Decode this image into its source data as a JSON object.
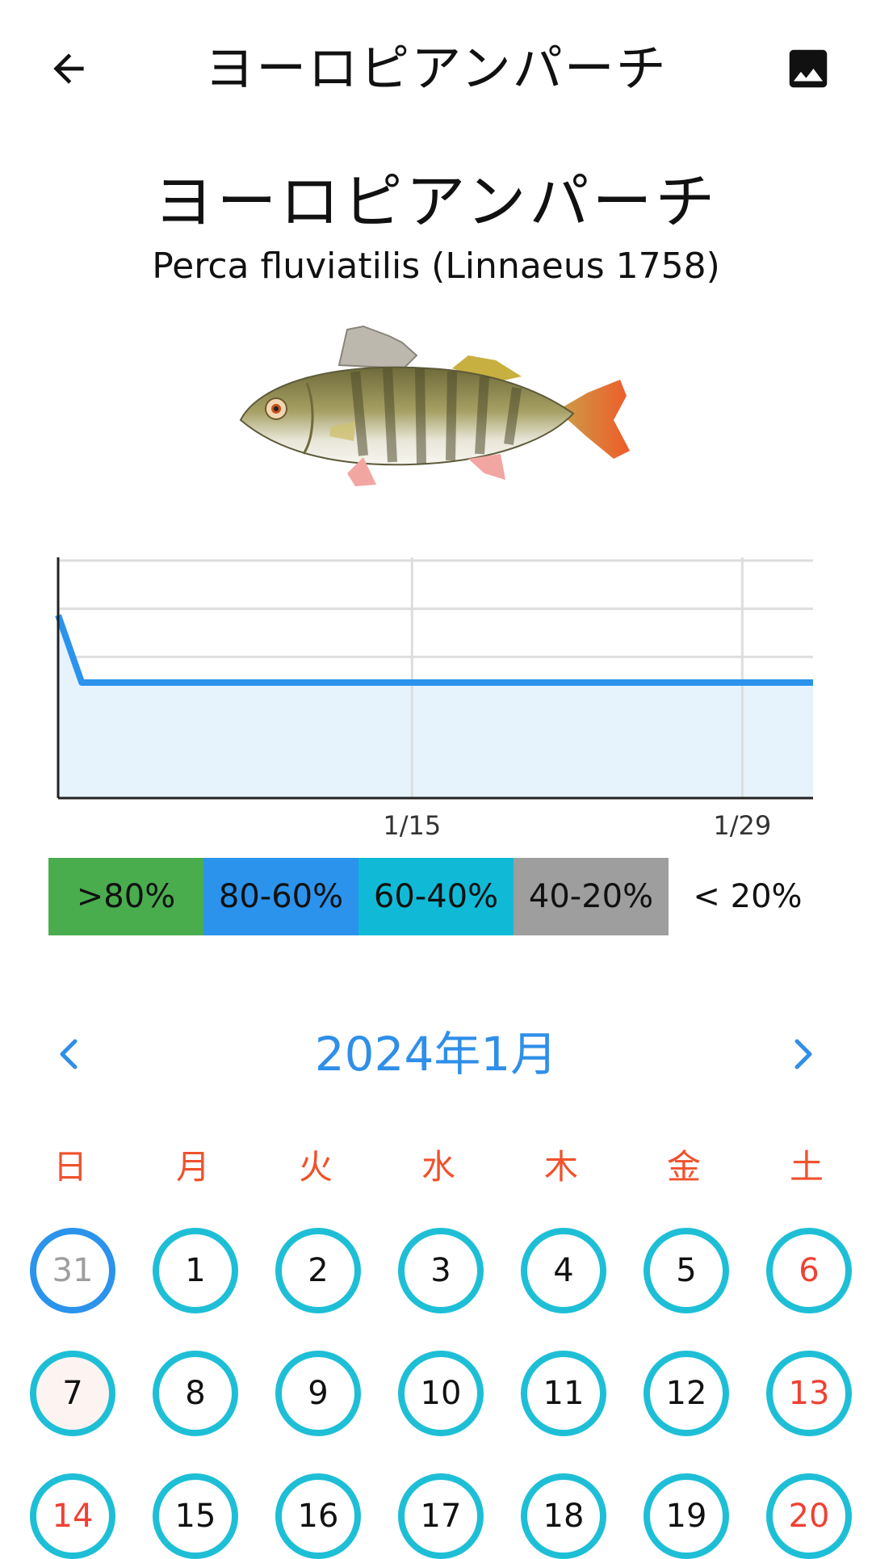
{
  "appbar": {
    "title": "ヨーロピアンパーチ",
    "back_icon": "arrow-back-icon",
    "image_icon": "image-icon"
  },
  "fish": {
    "name": "ヨーロピアンパーチ",
    "scientific": "Perca fluviatilis (Linnaeus 1758)"
  },
  "chart_data": {
    "type": "area",
    "x_tick_labels": [
      "1/15",
      "1/29"
    ],
    "points": [
      {
        "x": "12/31",
        "y": 0.76
      },
      {
        "x": "1/1",
        "y": 0.48
      },
      {
        "x": "2/1",
        "y": 0.48
      }
    ],
    "ylim": [
      0,
      1
    ],
    "grid": true,
    "line_color": "#2b93ec",
    "fill_color": "#e6f3fd"
  },
  "legend": [
    {
      "label": ">80%",
      "color": "#49ad4e"
    },
    {
      "label": "80-60%",
      "color": "#2b93ec"
    },
    {
      "label": "60-40%",
      "color": "#10bad6"
    },
    {
      "label": "40-20%",
      "color": "#9e9e9e"
    },
    {
      "label": "< 20%",
      "color": "#ffffff"
    }
  ],
  "calendar": {
    "month_label": "2024年1月",
    "prev_icon": "chevron-left-icon",
    "next_icon": "chevron-right-icon",
    "weekdays": [
      "日",
      "月",
      "火",
      "水",
      "木",
      "金",
      "土"
    ],
    "days": [
      {
        "label": "31",
        "outside_month": true
      },
      {
        "label": "1"
      },
      {
        "label": "2"
      },
      {
        "label": "3"
      },
      {
        "label": "4"
      },
      {
        "label": "5"
      },
      {
        "label": "6",
        "weekend": true
      },
      {
        "label": "7",
        "weekend": true,
        "today": true
      },
      {
        "label": "8"
      },
      {
        "label": "9"
      },
      {
        "label": "10"
      },
      {
        "label": "11"
      },
      {
        "label": "12"
      },
      {
        "label": "13",
        "weekend": true
      },
      {
        "label": "14",
        "weekend": true
      },
      {
        "label": "15"
      },
      {
        "label": "16"
      },
      {
        "label": "17"
      },
      {
        "label": "18"
      },
      {
        "label": "19"
      },
      {
        "label": "20",
        "weekend": true
      }
    ],
    "colors": {
      "ring": "#1ebfd6",
      "outside_ring": "#2b93ec",
      "weekend_text": "#ee4234",
      "outside_text": "#9e9e9e",
      "today_fill": "#fdf3f1"
    }
  }
}
